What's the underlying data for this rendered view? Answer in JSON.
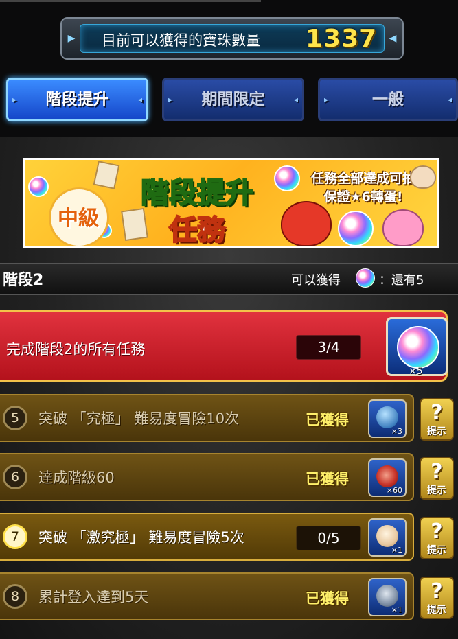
{
  "counter": {
    "label": "目前可以獲得的寶珠數量",
    "value": "1337"
  },
  "tabs": [
    {
      "label": "階段提升",
      "active": true
    },
    {
      "label": "期間限定",
      "active": false
    },
    {
      "label": "一般",
      "active": false
    }
  ],
  "banner": {
    "level": "中級",
    "title_line1": "階段提升",
    "title_line2": "任務",
    "promo_line1": "任務全部達成可抽",
    "promo_line2": "保證★6轉蛋!"
  },
  "stage": {
    "title": "階段2",
    "obtainable_label": "可以獲得",
    "remaining_label": "：還有5"
  },
  "main_mission": {
    "label": "完成階段2的所有任務",
    "progress": "3/4",
    "reward_qty": "×5"
  },
  "missions": [
    {
      "number": "5",
      "text": "突破 「究極」 難易度冒險10次",
      "status": "已獲得",
      "reward_icon": "cloth-bag-icon",
      "reward_qty": "×3",
      "hint": "提示"
    },
    {
      "number": "6",
      "text": "達成階級60",
      "status": "已獲得",
      "reward_icon": "meat-icon",
      "reward_qty": "×60",
      "hint": "提示"
    },
    {
      "number": "7",
      "text": "突破 「激究極」 難易度冒險5次",
      "progress": "0/5",
      "reward_icon": "egg-fossil-icon",
      "reward_qty": "×1",
      "hint": "提示"
    },
    {
      "number": "8",
      "text": "累計登入達到5天",
      "status": "已獲得",
      "reward_icon": "bell-icon",
      "reward_qty": "×1",
      "hint": "提示"
    }
  ],
  "colors": {
    "counter_value": "#ffe44a",
    "active_tab": "#3b8cff",
    "main_mission": "#d0202b",
    "mission_row": "#5e4510",
    "obtained": "#fff06a"
  }
}
